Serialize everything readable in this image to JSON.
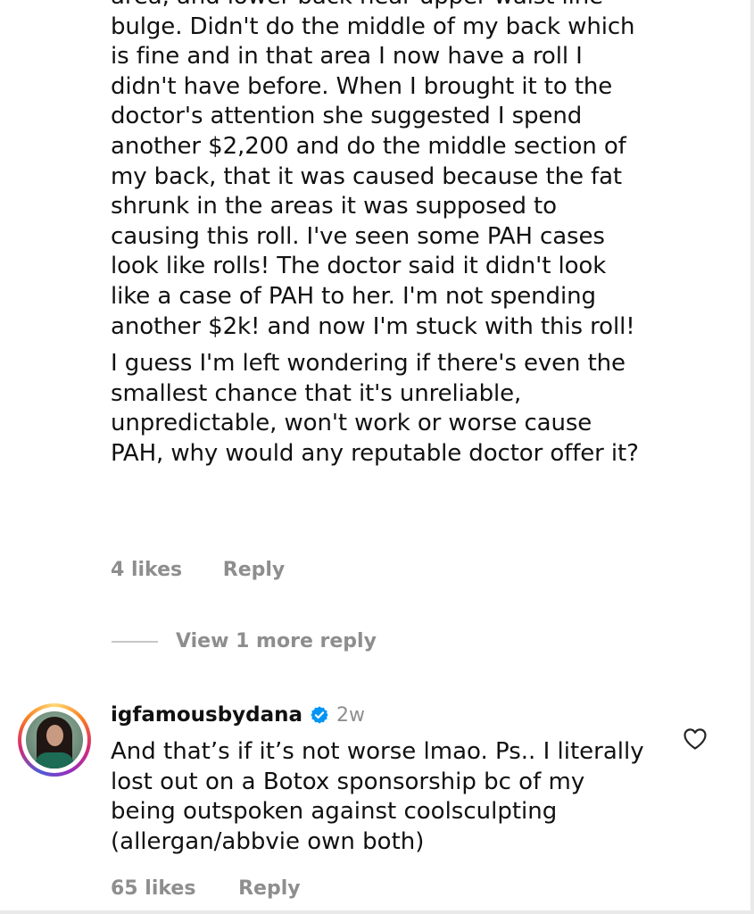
{
  "comment1": {
    "paragraphs": [
      "area, and lower back near upper waist line bulge. Didn't do the middle of my back which is fine and in that area I now have a roll I didn't have before. When I brought it to the doctor's attention she suggested I spend another $2,200 and do the middle section of my back, that it was caused because the fat shrunk in the areas it was supposed to causing this roll. I've seen some PAH cases look like rolls! The doctor said it didn't look like a case of PAH to her. I'm not spending another $2k! and now I'm stuck with this roll!",
      "I guess I'm left wondering if there's even the smallest chance that it's unreliable, unpredictable, won't work or worse cause PAH, why would any reputable doctor offer it?"
    ],
    "likes": "4 likes",
    "reply": "Reply",
    "view_more": "View 1 more reply"
  },
  "comment2": {
    "username": "igfamousbydana",
    "time": "2w",
    "text": "And that’s if it’s not worse lmao. Ps.. I literally lost out on a Botox sponsorship bc of my being outspoken against coolsculpting (allergan/abbvie own both)",
    "likes": "65 likes",
    "reply": "Reply",
    "icons": {
      "verified": "verified-badge-icon",
      "like": "heart-outline-icon",
      "avatar": "profile-photo"
    }
  },
  "colors": {
    "text": "#111111",
    "meta": "#8e8e8e",
    "verified": "#0095f6"
  }
}
